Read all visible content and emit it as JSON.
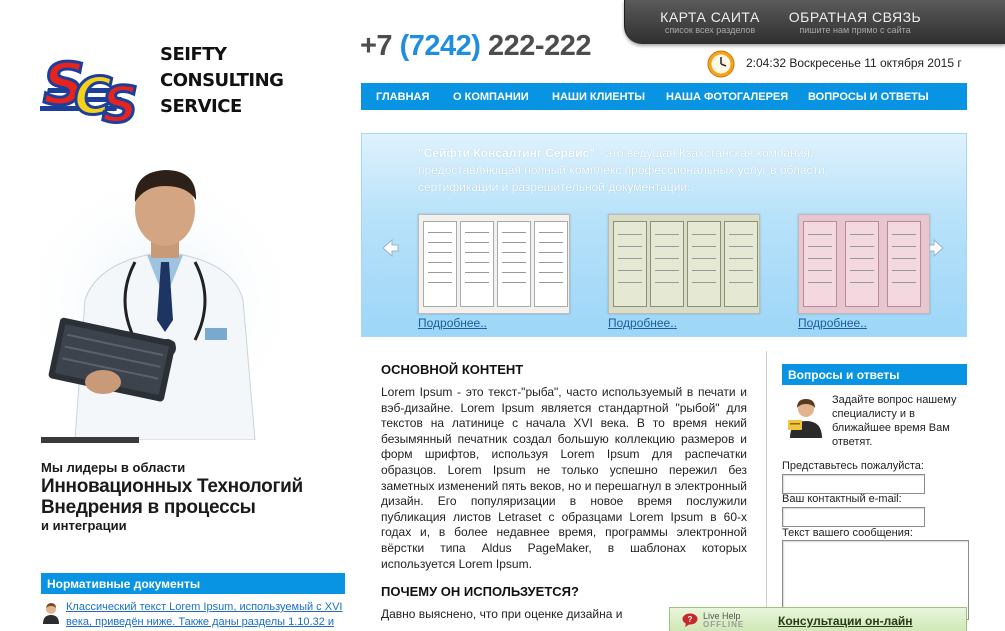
{
  "topbar": {
    "sitemap": {
      "title": "КАРТА САИТА",
      "subtitle": "список всех разделов"
    },
    "feedback": {
      "title": "ОБРАТНАЯ СВЯЗЬ",
      "subtitle": "пишите нам прямо с сайта"
    }
  },
  "logo": {
    "letters": "SCS",
    "name_line1": "SEIFTY",
    "name_line2": "CONSULTING",
    "name_line3": "SERVICE"
  },
  "phone": {
    "prefix": "+7",
    "code": "(7242)",
    "number": "222-222"
  },
  "datetime": "2:04:32 Воскресенье 11 октября 2015 г",
  "nav": [
    "ГЛАВНАЯ",
    "О КОМПАНИИ",
    "НАШИ КЛИЕНТЫ",
    "НАША ФОТОГАЛЕРЕЯ",
    "ВОПРОСЫ И ОТВЕТЫ"
  ],
  "slider": {
    "company_name": "\"Сейфти Консалтинг Сервис\"",
    "intro_rest": " - это ведущая Кзахстанская компания, предоставляющая полный комплекс профессиональных услуг в области сертификации и разрешительной документации..",
    "more_labels": [
      "Подробнее..",
      "Подробнее..",
      "Подробнее.."
    ]
  },
  "leader": {
    "line1": "Мы лидеры в области",
    "line2": "Инновационных Технологий",
    "line3": "Внедрения в процессы",
    "line4": "и интеграции"
  },
  "sidebar": {
    "heading": "Нормативные документы",
    "news_link": "Классический текст Lorem Ipsum, используемый с XVI века, приведён ниже. Также даны разделы 1.10.32 и"
  },
  "main": {
    "heading1": "ОСНОВНОЙ КОНТЕНТ",
    "paragraph1": "Lorem Ipsum - это текст-\"рыба\", часто используемый в печати и вэб-дизайне. Lorem Ipsum является стандартной \"рыбой\" для текстов на латинице с начала XVI века. В то время некий безымянный печатник создал большую коллекцию размеров и форм шрифтов, используя Lorem Ipsum для распечатки образцов. Lorem Ipsum не только успешно пережил без заметных изменений пять веков, но и перешагнул в электронный дизайн. Его популяризации в новое время послужили публикация листов Letraset с образцами Lorem Ipsum в 60-х годах и, в более недавнее время, программы электронной вёрстки типа Aldus PageMaker, в шаблонах которых используется Lorem Ipsum.",
    "heading2": "ПОЧЕМУ ОН ИСПОЛЬЗУЕТСЯ?",
    "paragraph2": "Давно выяснено, что при оценке дизайна и"
  },
  "faq": {
    "heading": "Вопросы и ответы",
    "text": "Задайте вопрос нашему специалисту и в ближайшее время Вам ответят.",
    "name_label": "Представьтесь пожалуйста:",
    "email_label": "Ваш контактный e-mail:",
    "message_label": "Текст вашего сообщения:"
  },
  "livehelp": {
    "line1": "Live Help",
    "line2": "OFFLINE",
    "consult": "Консультации он-лайн"
  },
  "colors": {
    "accent": "#0894e2",
    "phone_code": "#1f8ee0",
    "topbar": "#3a3a3a"
  }
}
